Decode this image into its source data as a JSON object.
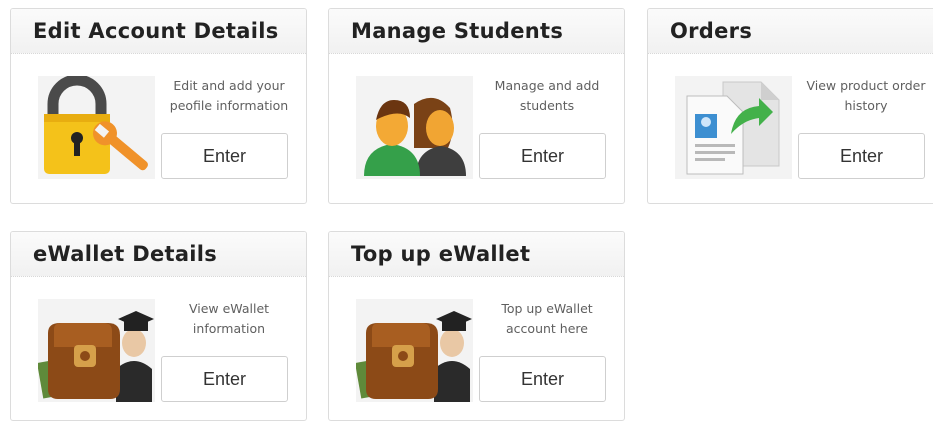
{
  "cards": [
    {
      "title": "Edit Account Details",
      "description": "Edit and add your peofile information",
      "button_label": "Enter",
      "icon": "padlock-wrench-icon"
    },
    {
      "title": "Manage Students",
      "description": "Manage and add students",
      "button_label": "Enter",
      "icon": "students-icon"
    },
    {
      "title": "Orders",
      "description": "View product order history",
      "button_label": "Enter",
      "icon": "documents-icon"
    },
    {
      "title": "eWallet Details",
      "description": "View eWallet information",
      "button_label": "Enter",
      "icon": "wallet-graduate-icon"
    },
    {
      "title": "Top up eWallet",
      "description": "Top up eWallet account here",
      "button_label": "Enter",
      "icon": "wallet-graduate-icon"
    }
  ]
}
